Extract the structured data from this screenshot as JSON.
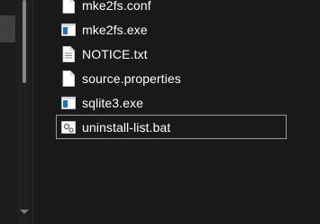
{
  "files": [
    {
      "name": "mke2fs.conf",
      "icon": "document-icon"
    },
    {
      "name": "mke2fs.exe",
      "icon": "exe-icon"
    },
    {
      "name": "NOTICE.txt",
      "icon": "text-file-icon"
    },
    {
      "name": "source.properties",
      "icon": "document-icon"
    },
    {
      "name": "sqlite3.exe",
      "icon": "exe-icon"
    },
    {
      "name": "uninstall-list.bat",
      "icon": "batch-file-icon"
    }
  ],
  "colors": {
    "background": "#191919",
    "text": "#ffffff",
    "exe_blue": "#1a73c9",
    "focus_border": "#9a9a9a"
  }
}
